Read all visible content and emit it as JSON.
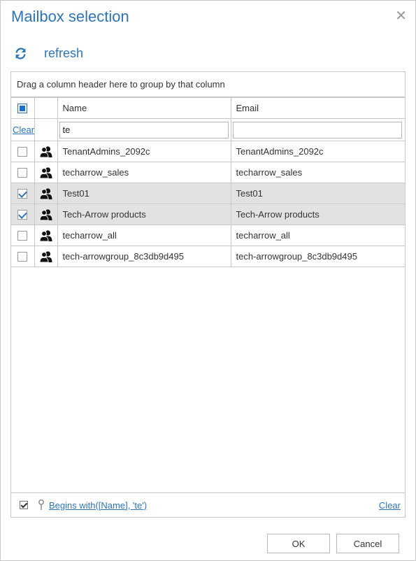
{
  "dialog": {
    "title": "Mailbox selection",
    "close_glyph": "✕"
  },
  "toolbar": {
    "refresh_icon": "refresh-icon",
    "refresh_label": "refresh"
  },
  "grid": {
    "group_hint": "Drag a column header here to group by that column",
    "columns": [
      "Name",
      "Email"
    ],
    "filter": {
      "clear_label": "Clear",
      "name_value": "te",
      "email_value": ""
    },
    "rows": [
      {
        "name": "TenantAdmins_2092c",
        "email": "TenantAdmins_2092c",
        "checked": false
      },
      {
        "name": "techarrow_sales",
        "email": "techarrow_sales",
        "checked": false
      },
      {
        "name": "Test01",
        "email": "Test01",
        "checked": true
      },
      {
        "name": "Tech-Arrow products",
        "email": "Tech-Arrow products",
        "checked": true
      },
      {
        "name": "techarrow_all",
        "email": "techarrow_all",
        "checked": false
      },
      {
        "name": "tech-arrowgroup_8c3db9d495",
        "email": "tech-arrowgroup_8c3db9d495",
        "checked": false
      }
    ],
    "row_icon": "group-icon",
    "footer": {
      "filter_expression": "Begins with([Name], 'te')",
      "clear_label": "Clear"
    }
  },
  "buttons": {
    "ok_label": "OK",
    "cancel_label": "Cancel"
  },
  "colors": {
    "accent": "#2f74b5",
    "selected_row": "#e2e2e2",
    "border": "#c8c8c8"
  }
}
